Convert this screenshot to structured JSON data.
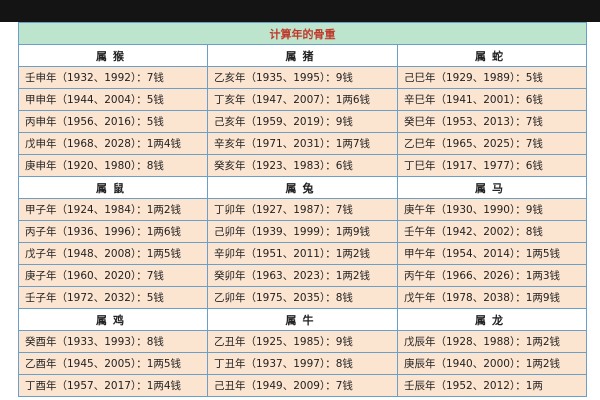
{
  "title": "计算年的骨重",
  "sections": [
    {
      "headers": [
        "属猴",
        "属猪",
        "属蛇"
      ],
      "rows": [
        [
          "壬申年（1932、1992）：7钱",
          "乙亥年（1935、1995）：9钱",
          "己巳年（1929、1989）：5钱"
        ],
        [
          "甲申年（1944、2004）：5钱",
          "丁亥年（1947、2007）：1两6钱",
          "辛巳年（1941、2001）：6钱"
        ],
        [
          "丙申年（1956、2016）：5钱",
          "己亥年（1959、2019）：9钱",
          "癸巳年（1953、2013）：7钱"
        ],
        [
          "戊申年（1968、2028）：1两4钱",
          "辛亥年（1971、2031）：1两7钱",
          "乙巳年（1965、2025）：7钱"
        ],
        [
          "庚申年（1920、1980）：8钱",
          "癸亥年（1923、1983）：6钱",
          "丁巳年（1917、1977）：6钱"
        ]
      ]
    },
    {
      "headers": [
        "属鼠",
        "属兔",
        "属马"
      ],
      "rows": [
        [
          "甲子年（1924、1984）：1两2钱",
          "丁卯年（1927、1987）：7钱",
          "庚午年（1930、1990）：9钱"
        ],
        [
          "丙子年（1936、1996）：1两6钱",
          "己卯年（1939、1999）：1两9钱",
          "壬午年（1942、2002）：8钱"
        ],
        [
          "戊子年（1948、2008）：1两5钱",
          "辛卯年（1951、2011）：1两2钱",
          "甲午年（1954、2014）：1两5钱"
        ],
        [
          "庚子年（1960、2020）：7钱",
          "癸卯年（1963、2023）：1两2钱",
          "丙午年（1966、2026）：1两3钱"
        ],
        [
          "壬子年（1972、2032）：5钱",
          "乙卯年（1975、2035）：8钱",
          "戊午年（1978、2038）：1两9钱"
        ]
      ]
    },
    {
      "headers": [
        "属鸡",
        "属牛",
        "属龙"
      ],
      "rows": [
        [
          "癸酉年（1933、1993）：8钱",
          "乙丑年（1925、1985）：9钱",
          "戊辰年（1928、1988）：1两2钱"
        ],
        [
          "乙酉年（1945、2005）：1两5钱",
          "丁丑年（1937、1997）：8钱",
          "庚辰年（1940、2000）：1两2钱"
        ],
        [
          "丁酉年（1957、2017）：1两4钱",
          "己丑年（1949、2009）：7钱",
          "壬辰年（1952、2012）：1两"
        ]
      ]
    }
  ]
}
